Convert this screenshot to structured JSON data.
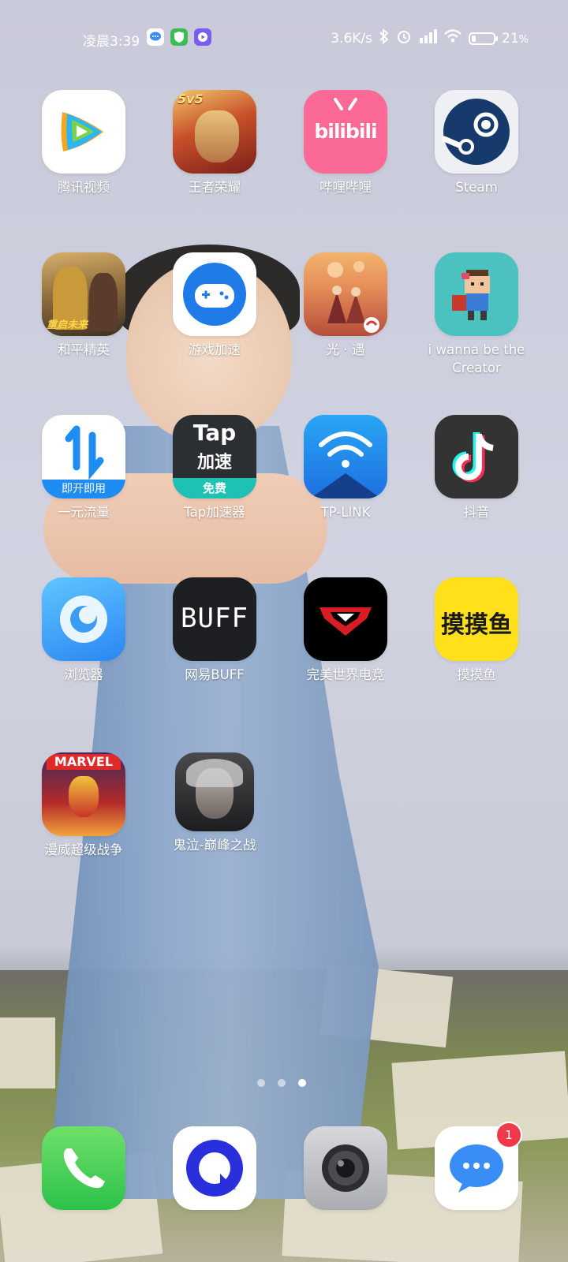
{
  "status_bar": {
    "time": "凌晨3:39",
    "net_speed": "3.6K/s",
    "battery": "21",
    "battery_unit": "%",
    "battery_level": 0.21
  },
  "apps": [
    {
      "label": "腾讯视频"
    },
    {
      "label": "王者荣耀",
      "icon_text": "5v5"
    },
    {
      "label": "哔哩哔哩",
      "icon_text": "bilibili"
    },
    {
      "label": "Steam"
    },
    {
      "label": "和平精英",
      "icon_text": "重启未来"
    },
    {
      "label": "游戏加速"
    },
    {
      "label": "光 · 遇"
    },
    {
      "label": "i wanna be the Creator"
    },
    {
      "label": "一元流量",
      "icon_text": "即开即用"
    },
    {
      "label": "Tap加速器",
      "icon_text_1": "Tap",
      "icon_text_2": "加速",
      "icon_text_3": "免费"
    },
    {
      "label": "TP-LINK"
    },
    {
      "label": "抖音"
    },
    {
      "label": "浏览器"
    },
    {
      "label": "网易BUFF",
      "icon_text": "BUFF"
    },
    {
      "label": "完美世界电竞"
    },
    {
      "label": "摸摸鱼",
      "icon_text": "摸摸鱼"
    },
    {
      "label": "漫威超级战争",
      "icon_text": "MARVEL"
    },
    {
      "label": "鬼泣-巅峰之战"
    }
  ],
  "dock": {
    "messages_badge": "1"
  },
  "page_indicator": {
    "count": 3,
    "active": 3
  }
}
